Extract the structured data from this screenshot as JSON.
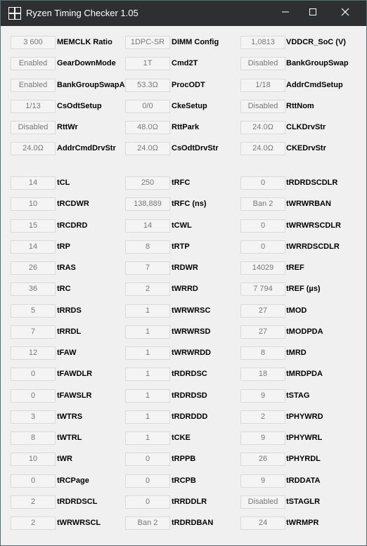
{
  "window": {
    "title": "Ryzen Timing Checker 1.05"
  },
  "icons": {
    "app": "ryzen-app-icon",
    "minimize": "minimize-icon",
    "maximize": "maximize-icon",
    "close": "close-icon"
  },
  "config_rows": [
    [
      {
        "value": "3 600",
        "label": "MEMCLK Ratio"
      },
      {
        "value": "1DPC-SR",
        "label": "DIMM Config"
      },
      {
        "value": "1,0813",
        "label": "VDDCR_SoC (V)"
      }
    ],
    [
      {
        "value": "Enabled",
        "label": "GearDownMode"
      },
      {
        "value": "1T",
        "label": "Cmd2T"
      },
      {
        "value": "Disabled",
        "label": "BankGroupSwap"
      }
    ],
    [
      {
        "value": "Enabled",
        "label": "BankGroupSwapAlt"
      },
      {
        "value": "53.3Ω",
        "label": "ProcODT"
      },
      {
        "value": "1/18",
        "label": "AddrCmdSetup"
      }
    ],
    [
      {
        "value": "1/13",
        "label": "CsOdtSetup"
      },
      {
        "value": "0/0",
        "label": "CkeSetup"
      },
      {
        "value": "Disabled",
        "label": "RttNom"
      }
    ],
    [
      {
        "value": "Disabled",
        "label": "RttWr"
      },
      {
        "value": "48.0Ω",
        "label": "RttPark"
      },
      {
        "value": "24.0Ω",
        "label": "CLKDrvStr"
      }
    ],
    [
      {
        "value": "24.0Ω",
        "label": "AddrCmdDrvStr"
      },
      {
        "value": "24.0Ω",
        "label": "CsOdtDrvStr"
      },
      {
        "value": "24.0Ω",
        "label": "CKEDrvStr"
      }
    ]
  ],
  "timing_rows": [
    [
      {
        "value": "14",
        "label": "tCL"
      },
      {
        "value": "250",
        "label": "tRFC"
      },
      {
        "value": "0",
        "label": "tRDRDSCDLR"
      }
    ],
    [
      {
        "value": "10",
        "label": "tRCDWR"
      },
      {
        "value": "138,889",
        "label": "tRFC (ns)"
      },
      {
        "value": "Ban 2",
        "label": "tWRWRBAN"
      }
    ],
    [
      {
        "value": "15",
        "label": "tRCDRD"
      },
      {
        "value": "14",
        "label": "tCWL"
      },
      {
        "value": "0",
        "label": "tWRWRSCDLR"
      }
    ],
    [
      {
        "value": "14",
        "label": "tRP"
      },
      {
        "value": "8",
        "label": "tRTP"
      },
      {
        "value": "0",
        "label": "tWRRDSCDLR"
      }
    ],
    [
      {
        "value": "26",
        "label": "tRAS"
      },
      {
        "value": "7",
        "label": "tRDWR"
      },
      {
        "value": "14029",
        "label": "tREF"
      }
    ],
    [
      {
        "value": "36",
        "label": "tRC"
      },
      {
        "value": "2",
        "label": "tWRRD"
      },
      {
        "value": "7 794",
        "label": "tREF (µs)"
      }
    ],
    [
      {
        "value": "5",
        "label": "tRRDS"
      },
      {
        "value": "1",
        "label": "tWRWRSC"
      },
      {
        "value": "27",
        "label": "tMOD"
      }
    ],
    [
      {
        "value": "7",
        "label": "tRRDL"
      },
      {
        "value": "1",
        "label": "tWRWRSD"
      },
      {
        "value": "27",
        "label": "tMODPDA"
      }
    ],
    [
      {
        "value": "12",
        "label": "tFAW"
      },
      {
        "value": "1",
        "label": "tWRWRDD"
      },
      {
        "value": "8",
        "label": "tMRD"
      }
    ],
    [
      {
        "value": "0",
        "label": "tFAWDLR"
      },
      {
        "value": "1",
        "label": "tRDRDSC"
      },
      {
        "value": "18",
        "label": "tMRDPDA"
      }
    ],
    [
      {
        "value": "0",
        "label": "tFAWSLR"
      },
      {
        "value": "1",
        "label": "tRDRDSD"
      },
      {
        "value": "9",
        "label": "tSTAG"
      }
    ],
    [
      {
        "value": "3",
        "label": "tWTRS"
      },
      {
        "value": "1",
        "label": "tRDRDDD"
      },
      {
        "value": "2",
        "label": "tPHYWRD"
      }
    ],
    [
      {
        "value": "8",
        "label": "tWTRL"
      },
      {
        "value": "1",
        "label": "tCKE"
      },
      {
        "value": "9",
        "label": "tPHYWRL"
      }
    ],
    [
      {
        "value": "10",
        "label": "tWR"
      },
      {
        "value": "0",
        "label": "tRPPB"
      },
      {
        "value": "26",
        "label": "tPHYRDL"
      }
    ],
    [
      {
        "value": "0",
        "label": "tRCPage"
      },
      {
        "value": "0",
        "label": "tRCPB"
      },
      {
        "value": "9",
        "label": "tRDDATA"
      }
    ],
    [
      {
        "value": "2",
        "label": "tRDRDSCL"
      },
      {
        "value": "0",
        "label": "tRRDDLR"
      },
      {
        "value": "Disabled",
        "label": "tSTAGLR"
      }
    ],
    [
      {
        "value": "2",
        "label": "tWRWRSCL"
      },
      {
        "value": "Ban 2",
        "label": "tRDRDBAN"
      },
      {
        "value": "24",
        "label": "tWRMPR"
      }
    ]
  ]
}
